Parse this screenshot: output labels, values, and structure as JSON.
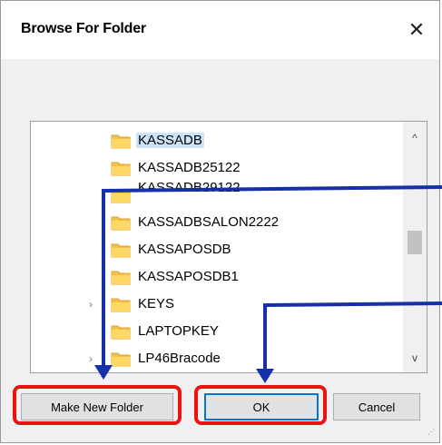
{
  "window": {
    "title": "Browse For Folder",
    "close_icon": "close-icon"
  },
  "tree": {
    "items": [
      {
        "label": "KASSADB",
        "selected": true,
        "expandable": false
      },
      {
        "label": "KASSADB25122",
        "selected": false,
        "expandable": false
      },
      {
        "label": "KASSADB29122",
        "selected": false,
        "expandable": false
      },
      {
        "label": "KASSADBSALON2222",
        "selected": false,
        "expandable": false
      },
      {
        "label": "KASSAPOSDB",
        "selected": false,
        "expandable": false
      },
      {
        "label": "KASSAPOSDB1",
        "selected": false,
        "expandable": false
      },
      {
        "label": "KEYS",
        "selected": false,
        "expandable": true
      },
      {
        "label": "LAPTOPKEY",
        "selected": false,
        "expandable": false
      },
      {
        "label": "LP46Bracode",
        "selected": false,
        "expandable": true
      }
    ],
    "chevron_glyph": "›",
    "scroll_up_glyph": "^",
    "scroll_down_glyph": "v"
  },
  "buttons": {
    "make_new_folder": "Make New Folder",
    "ok": "OK",
    "cancel": "Cancel"
  },
  "annotations": {
    "highlight_color": "#ee1111",
    "arrow_color": "#1530a8"
  },
  "colors": {
    "selection": "#cce4f7",
    "folder": "#f2c24a",
    "ok_border": "#0078d7"
  }
}
